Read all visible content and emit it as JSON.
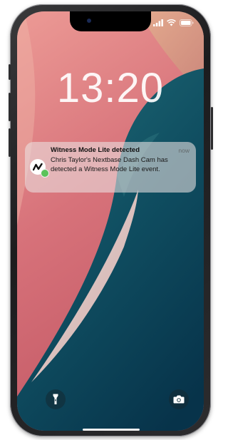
{
  "lock_screen": {
    "time": "13:20"
  },
  "notification": {
    "title": "Witness Mode Lite detected",
    "time": "now",
    "body": "Chris Taylor's Nextbase Dash Cam has detected a Witness Mode Lite event."
  },
  "status_bar": {
    "icons": [
      "signal-icon",
      "wifi-icon",
      "battery-icon"
    ]
  },
  "quick_actions": {
    "left_icon": "flashlight-icon",
    "right_icon": "camera-icon"
  },
  "colors": {
    "wallpaper_pink": "#d8747a",
    "wallpaper_teal": "#0f4a5c",
    "wallpaper_light": "#f3d9d6",
    "frame": "#2c2c2e"
  }
}
